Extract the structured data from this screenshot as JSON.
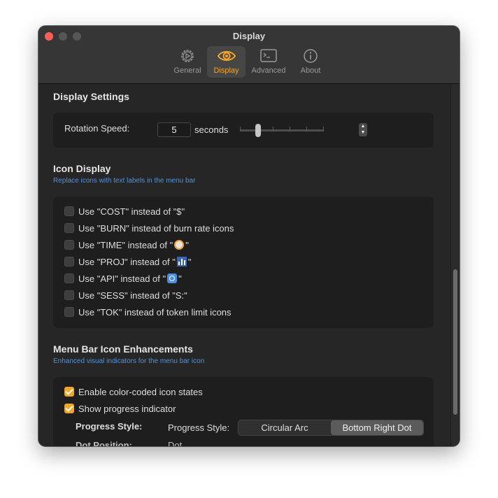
{
  "window": {
    "title": "Display"
  },
  "tabs": [
    {
      "label": "General",
      "icon": "gear-icon",
      "selected": false
    },
    {
      "label": "Display",
      "icon": "eye-icon",
      "selected": true
    },
    {
      "label": "Advanced",
      "icon": "terminal-icon",
      "selected": false
    },
    {
      "label": "About",
      "icon": "info-icon",
      "selected": false
    }
  ],
  "display_settings": {
    "title": "Display Settings",
    "rotation_label": "Rotation Speed:",
    "rotation_value": "5",
    "rotation_unit": "seconds",
    "slider_level_fraction": 0.2
  },
  "icon_display": {
    "title": "Icon Display",
    "subtitle": "Replace icons with text labels in the menu bar",
    "items": [
      {
        "label": "Use \"COST\" instead of \"$\"",
        "checked": false
      },
      {
        "label": "Use \"BURN\" instead of burn rate icons",
        "checked": false
      },
      {
        "label_pre": "Use \"TIME\" instead of \"",
        "label_post": "\"",
        "emoji": "stopwatch-icon",
        "checked": false
      },
      {
        "label_pre": "Use \"PROJ\" instead of \"",
        "label_post": "\"",
        "emoji": "bar-chart-icon",
        "checked": false
      },
      {
        "label_pre": "Use \"API\" instead of \"",
        "label_post": "\"",
        "emoji": "refresh-icon",
        "checked": false
      },
      {
        "label": "Use \"SESS\" instead of \"S:\"",
        "checked": false
      },
      {
        "label": "Use \"TOK\" instead of token limit icons",
        "checked": false
      }
    ]
  },
  "enhancements": {
    "title": "Menu Bar Icon Enhancements",
    "subtitle": "Enhanced visual indicators for the menu bar icon",
    "color_coded_label": "Enable color-coded icon states",
    "color_coded_checked": true,
    "progress_label": "Show progress indicator",
    "progress_checked": true,
    "progress_style_label": "Progress Style:",
    "progress_style_inner_label": "Progress Style:",
    "progress_style_options": [
      "Circular Arc",
      "Bottom Right Dot"
    ],
    "progress_style_selected": "Bottom Right Dot",
    "dot_position_label": "Dot Position:",
    "dot_position_value": "Dot"
  },
  "colors": {
    "accent": "#f4a62a",
    "link": "#4e93e0",
    "close": "#fe5f57"
  }
}
